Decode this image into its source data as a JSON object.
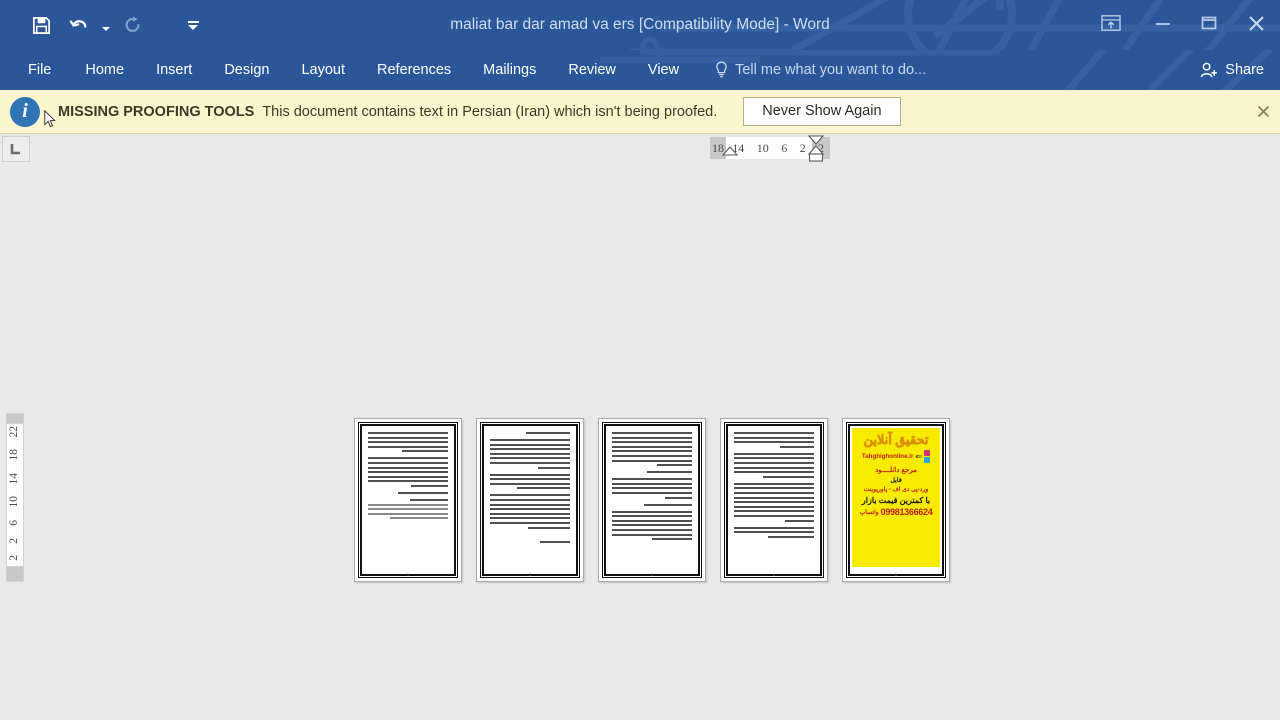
{
  "window": {
    "title": "maliat bar dar amad va ers [Compatibility Mode] - Word",
    "accent_color": "#2b579a",
    "quick_access": [
      {
        "name": "save",
        "label": "Save",
        "icon": "save-icon",
        "enabled": true
      },
      {
        "name": "undo",
        "label": "Undo",
        "icon": "undo-icon",
        "enabled": true
      },
      {
        "name": "redo",
        "label": "Repeat",
        "icon": "redo-icon",
        "enabled": false
      },
      {
        "name": "customize",
        "label": "Customize Quick Access Toolbar",
        "icon": "chevron-down-icon",
        "enabled": true
      }
    ],
    "controls": [
      {
        "name": "ribbon-display-options",
        "label": "Ribbon Display Options",
        "icon": "ribbon-options-icon"
      },
      {
        "name": "minimize",
        "label": "Minimize",
        "icon": "minimize-icon"
      },
      {
        "name": "restore",
        "label": "Restore Down",
        "icon": "restore-icon"
      },
      {
        "name": "close",
        "label": "Close",
        "icon": "close-icon"
      }
    ]
  },
  "ribbon": {
    "tabs": [
      {
        "id": "file",
        "label": "File"
      },
      {
        "id": "home",
        "label": "Home"
      },
      {
        "id": "insert",
        "label": "Insert"
      },
      {
        "id": "design",
        "label": "Design"
      },
      {
        "id": "layout",
        "label": "Layout"
      },
      {
        "id": "references",
        "label": "References"
      },
      {
        "id": "mailings",
        "label": "Mailings"
      },
      {
        "id": "review",
        "label": "Review"
      },
      {
        "id": "view",
        "label": "View"
      }
    ],
    "tell_me": "Tell me what you want to do...",
    "share_label": "Share"
  },
  "notification": {
    "icon": "info-icon",
    "title": "MISSING PROOFING TOOLS",
    "message": "This document contains text in Persian (Iran) which isn't being proofed.",
    "button_label": "Never Show Again",
    "close_label": "Close",
    "background_color": "#fbf5cd"
  },
  "rulers": {
    "tab_selector": "L",
    "tab_selector_name": "left-tab-stop",
    "horizontal_ticks": [
      "18",
      "14",
      "10",
      "6",
      "2",
      "2"
    ],
    "vertical_ticks": [
      "2",
      "2",
      "6",
      "10",
      "14",
      "18",
      "22"
    ]
  },
  "document": {
    "pages": [
      {
        "number": "1",
        "type": "text",
        "page_label": "1"
      },
      {
        "number": "2",
        "type": "text",
        "page_label": "2"
      },
      {
        "number": "3",
        "type": "text",
        "page_label": "3"
      },
      {
        "number": "4",
        "type": "text",
        "page_label": "4"
      },
      {
        "number": "5",
        "type": "advertisement",
        "page_label": "5"
      }
    ],
    "ad_page": {
      "logo": "تحقیق آنلاین",
      "site": "Tahghighonline.ir",
      "line1": "مرجع دانلــــود",
      "line2": "فایل",
      "line3": "ورد-پی دی اف - پاورپوینت",
      "line4": "با کمترین قیمت بازار",
      "phone": "09981366624",
      "whatsapp_label": "واتساپ",
      "background_color": "#f7ec00",
      "accent_color": "#c02020"
    }
  }
}
